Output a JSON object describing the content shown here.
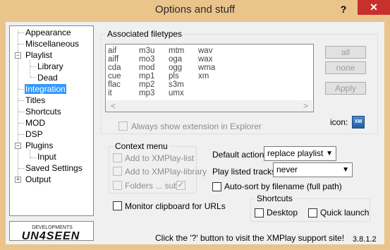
{
  "window": {
    "title": "Options and stuff",
    "help": "?",
    "close": "✕"
  },
  "tree": [
    {
      "label": "Appearance"
    },
    {
      "label": "Miscellaneous"
    },
    {
      "label": "Playlist",
      "expander": "−"
    },
    {
      "label": "Library"
    },
    {
      "label": "Dead"
    },
    {
      "label": "Integration",
      "selected": true
    },
    {
      "label": "Titles"
    },
    {
      "label": "Shortcuts"
    },
    {
      "label": "MOD"
    },
    {
      "label": "DSP"
    },
    {
      "label": "Plugins",
      "expander": "−"
    },
    {
      "label": "Input"
    },
    {
      "label": "Saved Settings"
    },
    {
      "label": "Output",
      "expander": "+"
    }
  ],
  "assoc": {
    "title": "Associated filetypes",
    "filetypes": [
      [
        "aif",
        "aiff",
        "cda",
        "cue",
        "flac",
        "it"
      ],
      [
        "m3u",
        "mo3",
        "mod",
        "mp1",
        "mp2",
        "mp3"
      ],
      [
        "mtm",
        "oga",
        "ogg",
        "pls",
        "s3m",
        "umx"
      ],
      [
        "wav",
        "wax",
        "wma",
        "xm"
      ]
    ],
    "scroll_left": "<",
    "scroll_right": ">",
    "all": "all",
    "none": "none",
    "apply": "Apply",
    "always_show": "Always show extension in Explorer",
    "icon_label": "icon:",
    "icon_glyph": "XM"
  },
  "context": {
    "title": "Context menu",
    "add_list": "Add to XMPlay-list",
    "add_library": "Add to XMPlay-library",
    "folders": "Folders ... sub",
    "sub_check": "✓"
  },
  "default_action": {
    "label": "Default action:",
    "value": "replace playlist"
  },
  "play_listed": {
    "label": "Play listed tracks:",
    "value": "never"
  },
  "autosort": "Auto-sort by filename (full path)",
  "monitor": "Monitor clipboard for URLs",
  "shortcuts": {
    "title": "Shortcuts",
    "desktop": "Desktop",
    "quick": "Quick launch"
  },
  "footer": {
    "support": "Click the '?' button to visit the XMPlay support site!",
    "version": "3.8.1.2"
  },
  "logo": {
    "text": "UN4SEEN",
    "sub": "DEVELOPMENTS"
  }
}
